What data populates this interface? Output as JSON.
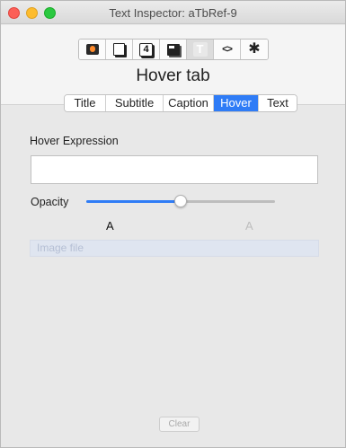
{
  "window": {
    "title": "Text Inspector: aTbRef-9"
  },
  "toolbar": {
    "buttons": [
      {
        "icon": "badge-icon",
        "label": ""
      },
      {
        "icon": "page-icon",
        "label": ""
      },
      {
        "icon": "number-icon",
        "label": "4"
      },
      {
        "icon": "dark-page-icon",
        "label": ""
      },
      {
        "icon": "text-T-icon",
        "label": "T"
      },
      {
        "icon": "code-icon",
        "label": "<>"
      },
      {
        "icon": "gear-icon",
        "label": "✱"
      }
    ],
    "selected_index": 4
  },
  "section": {
    "title": "Hover tab"
  },
  "tabs": [
    {
      "label": "Title"
    },
    {
      "label": "Subtitle"
    },
    {
      "label": "Caption"
    },
    {
      "label": "Hover",
      "active": true
    },
    {
      "label": "Text"
    }
  ],
  "hover": {
    "expression_label": "Hover Expression",
    "expression_value": "",
    "opacity_label": "Opacity",
    "opacity_value": 0.5,
    "sample_strong": "A",
    "sample_faint": "A",
    "image_file_placeholder": "Image file",
    "clear_label": "Clear"
  },
  "colors": {
    "accent": "#2f7cf6"
  }
}
